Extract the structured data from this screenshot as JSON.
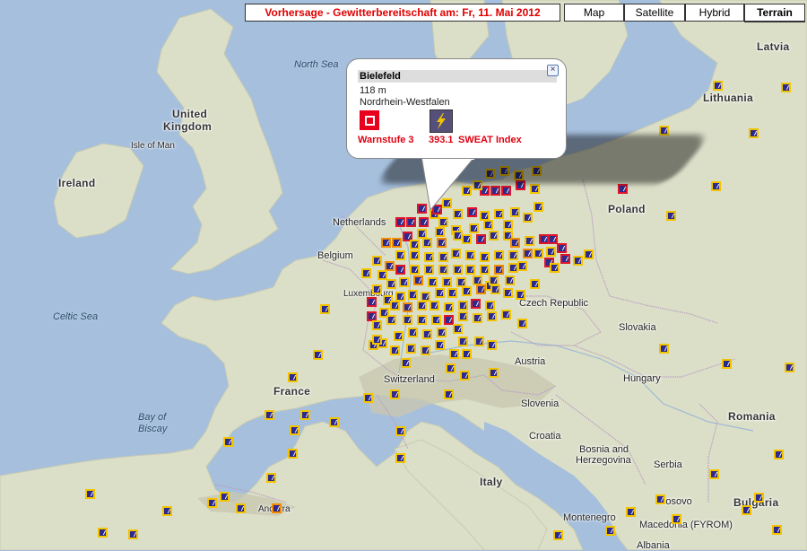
{
  "title": "Vorhersage - Gewitterbereitschaft am: Fr, 11. Mai 2012",
  "map_types": [
    {
      "label": "Map",
      "active": false
    },
    {
      "label": "Satellite",
      "active": false
    },
    {
      "label": "Hybrid",
      "active": false
    },
    {
      "label": "Terrain",
      "active": true
    }
  ],
  "popup": {
    "title": "Bielefeld",
    "elevation": "118 m",
    "region": "Nordrhein-Westfalen",
    "warning_label": "Warnstufe 3",
    "sweat_value": "393.1",
    "sweat_label": "SWEAT Index",
    "close_icon": "close-icon",
    "warning_icon": "warning-level-icon",
    "storm_icon": "lightning-icon"
  },
  "labels": {
    "north_sea": "North Sea",
    "united_kingdom_1": "United",
    "united_kingdom_2": "Kingdom",
    "isle_of_man": "Isle of Man",
    "ireland": "Ireland",
    "celtic_sea": "Celtic Sea",
    "netherlands": "Netherlands",
    "belgium": "Belgium",
    "luxembourg": "Luxembourg",
    "france": "France",
    "bay_of_biscay_1": "Bay of",
    "bay_of_biscay_2": "Biscay",
    "switzerland": "Switzerland",
    "austria": "Austria",
    "czech": "Czech Republic",
    "poland": "Poland",
    "latvia": "Latvia",
    "lithuania": "Lithuania",
    "slovakia": "Slovakia",
    "hungary": "Hungary",
    "slovenia": "Slovenia",
    "croatia": "Croatia",
    "bosnia_1": "Bosnia and",
    "bosnia_2": "Herzegovina",
    "serbia": "Serbia",
    "romania": "Romania",
    "bulgaria": "Bulgaria",
    "kosovo": "Kosovo",
    "montenegro": "Montenegro",
    "macedonia": "Macedonia (FYROM)",
    "italy": "Italy",
    "andorra": "Andorra",
    "albania": "Albania"
  },
  "colors": {
    "sea": "#a5bfdd",
    "land": "#d9dcc4",
    "marker_fill": "#2d2a8c",
    "level1": "#f2c400",
    "level2": "#f28c00",
    "level3": "#e0152a",
    "title_text": "#e00000"
  }
}
